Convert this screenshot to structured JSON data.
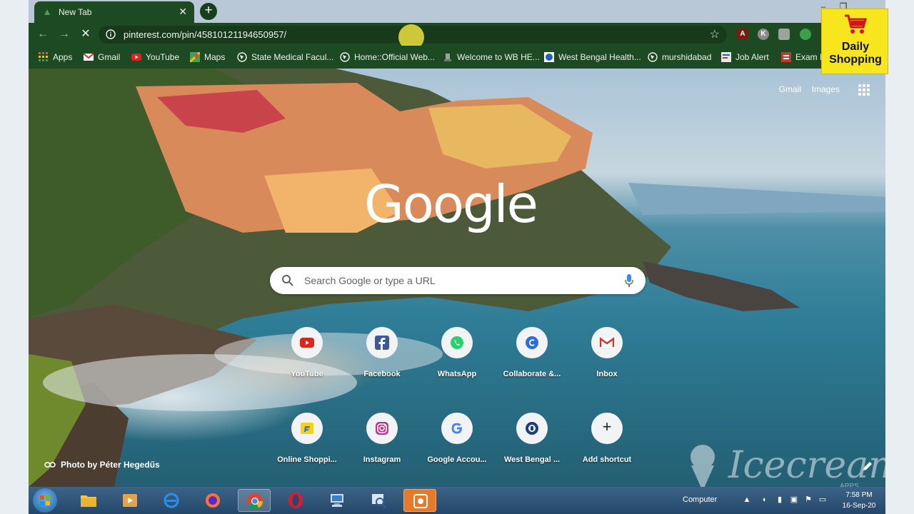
{
  "browser": {
    "tab": {
      "title": "New Tab",
      "close_glyph": "✕"
    },
    "new_tab_glyph": "+",
    "window_controls": [
      "–",
      "❐",
      "✕"
    ],
    "toolbar": {
      "back_glyph": "←",
      "forward_glyph": "→",
      "stop_glyph": "✕",
      "url": "pinterest.com/pin/45810121194650957/",
      "star_glyph": "☆",
      "profile_initial": "K"
    },
    "bookmarks": [
      {
        "label": "Apps",
        "icon": "apps-grid-icon"
      },
      {
        "label": "Gmail",
        "icon": "gmail-icon"
      },
      {
        "label": "YouTube",
        "icon": "youtube-icon"
      },
      {
        "label": "Maps",
        "icon": "maps-icon"
      },
      {
        "label": "State Medical Facul...",
        "icon": "globe-icon"
      },
      {
        "label": "Home::Official Web...",
        "icon": "globe-icon"
      },
      {
        "label": "Welcome to WB HE...",
        "icon": "emblem-icon"
      },
      {
        "label": "West Bengal Health...",
        "icon": "health-icon"
      },
      {
        "label": "murshidabad",
        "icon": "globe-icon"
      },
      {
        "label": "Job Alert",
        "icon": "job-alert-icon"
      },
      {
        "label": "Exam B",
        "icon": "exam-icon"
      }
    ]
  },
  "ntp": {
    "top_links": {
      "gmail": "Gmail",
      "images": "Images"
    },
    "logo": "Google",
    "search_placeholder": "Search Google or type a URL",
    "shortcuts_row1": [
      {
        "label": "YouTube",
        "icon": "youtube-icon"
      },
      {
        "label": "Facebook",
        "icon": "facebook-icon"
      },
      {
        "label": "WhatsApp",
        "icon": "whatsapp-icon"
      },
      {
        "label": "Collaborate &...",
        "icon": "collaborate-icon"
      },
      {
        "label": "Inbox",
        "icon": "gmail-icon"
      }
    ],
    "shortcuts_row2": [
      {
        "label": "Online Shoppi...",
        "icon": "flipkart-icon"
      },
      {
        "label": "Instagram",
        "icon": "instagram-icon"
      },
      {
        "label": "Google Accou...",
        "icon": "google-icon"
      },
      {
        "label": "West Bengal ...",
        "icon": "emblem-icon"
      },
      {
        "label": "Add shortcut",
        "icon": "plus-icon"
      }
    ],
    "add_glyph": "+",
    "photo_credit": "Photo by Péter Hegedűs"
  },
  "badge": {
    "line1": "Daily",
    "line2": "Shopping"
  },
  "watermark": {
    "text": "Icecream",
    "sub": "APPS"
  },
  "taskbar": {
    "computer_label": "Computer",
    "time": "7:58 PM",
    "date": "16-Sep-20"
  },
  "colors": {
    "chrome_theme": "#1e4a23",
    "omnibox": "#173a1b",
    "taskbar": "#24476a",
    "badge": "#f7e51e"
  }
}
